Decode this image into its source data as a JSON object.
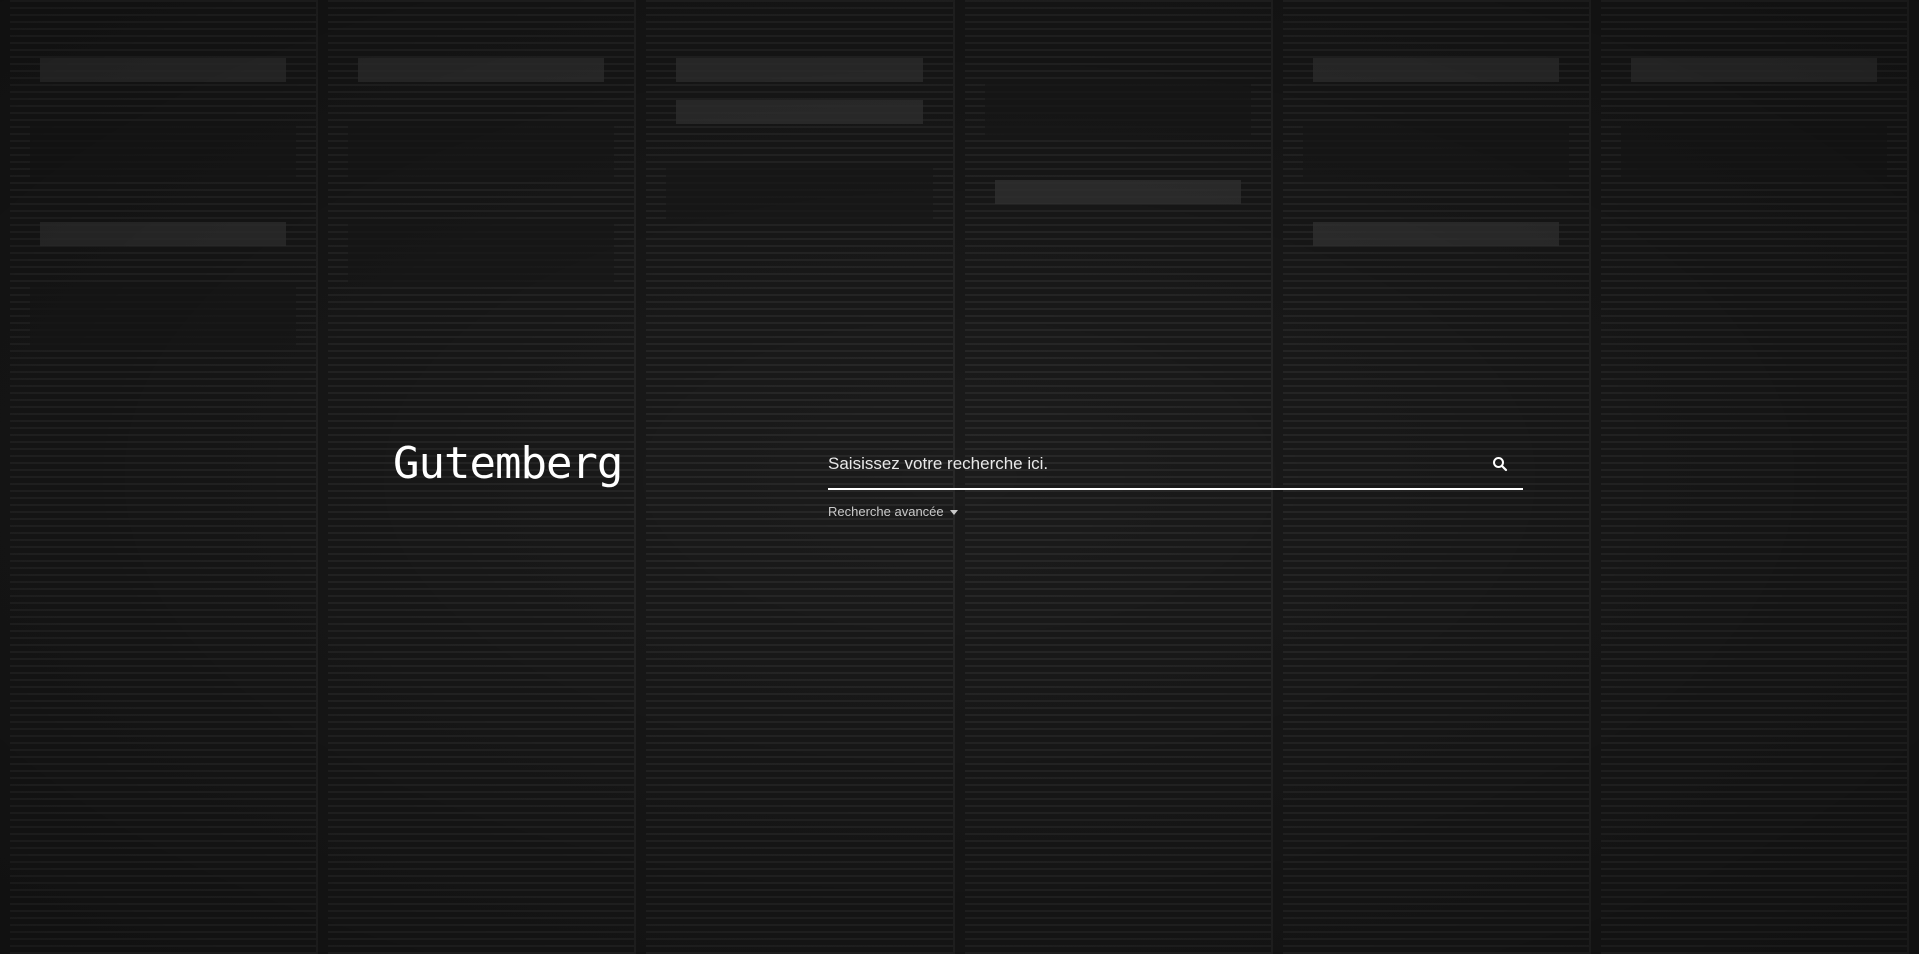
{
  "brand": {
    "name": "Gutemberg"
  },
  "search": {
    "placeholder": "Saisissez votre recherche ici.",
    "value": "",
    "icon": "search-icon",
    "advanced_label": "Recherche avancée",
    "advanced_icon": "caret-down-icon"
  },
  "colors": {
    "text": "#ffffff",
    "muted": "#c9c9c9",
    "background": "#1e1e1e"
  }
}
